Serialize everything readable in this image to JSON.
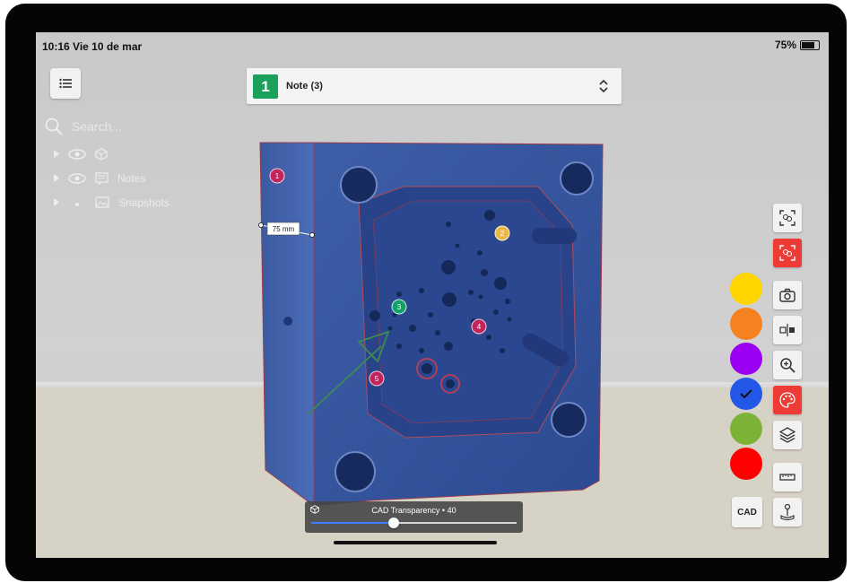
{
  "status": {
    "time": "10:16 Vie 10 de mar",
    "battery": "75%",
    "battery_level": 0.75
  },
  "menu": {
    "icon": "list-icon"
  },
  "note": {
    "badge": "1",
    "label": "Note (3)"
  },
  "search": {
    "placeholder": "Search..."
  },
  "tree": {
    "items": [
      {
        "label": "",
        "icon": "cube-icon"
      },
      {
        "label": "Notes",
        "icon": "note-icon"
      },
      {
        "label": "Snapshots",
        "icon": "image-icon"
      }
    ]
  },
  "model": {
    "measure_label": "75 mm",
    "markers": [
      {
        "num": "1",
        "color": "#c2255c"
      },
      {
        "num": "2",
        "color": "#e8b94a"
      },
      {
        "num": "3",
        "color": "#12a16a"
      },
      {
        "num": "4",
        "color": "#c2255c"
      },
      {
        "num": "5",
        "color": "#c2255c"
      }
    ]
  },
  "colors": {
    "swatches": [
      "#ffd500",
      "#f5821f",
      "#9b00f2",
      "#2357e8",
      "#7cb236",
      "#ff0000"
    ],
    "selected_index": 3,
    "accent": "#ee3b36"
  },
  "tools": [
    "scan-icon",
    "scan-active-icon",
    "camera-icon",
    "compare-icon",
    "zoom-in-icon",
    "palette-icon",
    "layers-icon",
    "ruler-icon",
    "anchor-icon"
  ],
  "cad_button": "CAD",
  "transparency": {
    "label": "CAD Transparency • 40",
    "value": 40
  }
}
